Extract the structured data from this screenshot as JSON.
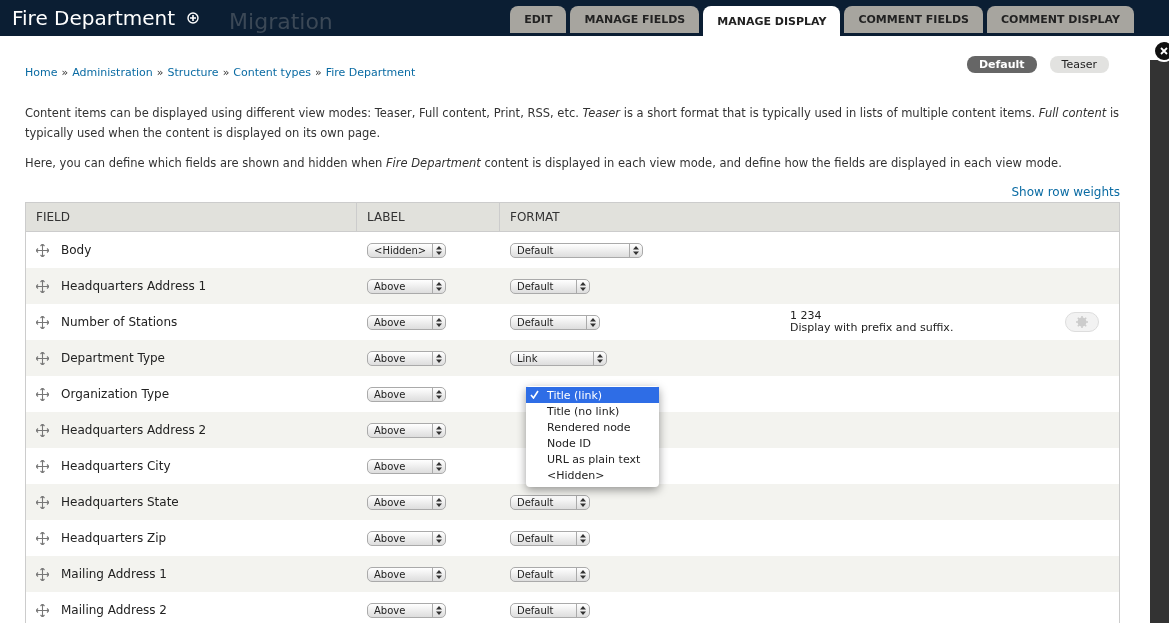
{
  "header": {
    "title": "Fire Department",
    "logo_text": "Migration"
  },
  "tabs": [
    {
      "label": "EDIT",
      "selected": false
    },
    {
      "label": "MANAGE FIELDS",
      "selected": false
    },
    {
      "label": "MANAGE DISPLAY",
      "selected": true
    },
    {
      "label": "COMMENT FIELDS",
      "selected": false
    },
    {
      "label": "COMMENT DISPLAY",
      "selected": false
    }
  ],
  "breadcrumb": {
    "separator": "»",
    "links": [
      "Home",
      "Administration",
      "Structure",
      "Content types",
      "Fire Department"
    ]
  },
  "view_modes": [
    {
      "label": "Default",
      "selected": true
    },
    {
      "label": "Teaser",
      "selected": false
    }
  ],
  "intro": [
    "Content items can be displayed using different view modes: Teaser, Full content, Print, RSS, etc. *Teaser* is a short format that is typically used in lists of multiple content items. *Full content* is typically used when the content is displayed on its own page.",
    "Here, you can define which fields are shown and hidden when *Fire Department* content is displayed in each view mode, and define how the fields are displayed in each view mode."
  ],
  "row_weights_link": "Show row weights",
  "table": {
    "columns": [
      "FIELD",
      "LABEL",
      "FORMAT"
    ],
    "rows": [
      {
        "field": "Body",
        "label": "<Hidden>",
        "format": "Default",
        "kind": "wide"
      },
      {
        "field": "Headquarters Address 1",
        "label": "Above",
        "format": "Default"
      },
      {
        "field": "Number of Stations",
        "label": "Above",
        "format": "Default",
        "summary": [
          "1 234",
          "Display with prefix and suffix."
        ]
      },
      {
        "field": "Department Type",
        "label": "Above",
        "format": "Link"
      },
      {
        "field": "Organization Type",
        "label": "Above",
        "menu": [
          {
            "label": "Title (link)",
            "selected": true
          },
          {
            "label": "Title (no link)",
            "selected": false
          },
          {
            "label": "Rendered node",
            "selected": false
          },
          {
            "label": "Node ID",
            "selected": false
          },
          {
            "label": "URL as plain text",
            "selected": false
          },
          {
            "label": "<Hidden>",
            "selected": false
          }
        ]
      },
      {
        "field": "Headquarters Address 2",
        "label": "Above"
      },
      {
        "field": "Headquarters City",
        "label": "Above"
      },
      {
        "field": "Headquarters State",
        "label": "Above",
        "format": "Default"
      },
      {
        "field": "Headquarters Zip",
        "label": "Above",
        "format": "Default"
      },
      {
        "field": "Mailing Address 1",
        "label": "Above",
        "format": "Default"
      },
      {
        "field": "Mailing Address 2",
        "label": "Above",
        "format": "Default"
      }
    ]
  }
}
